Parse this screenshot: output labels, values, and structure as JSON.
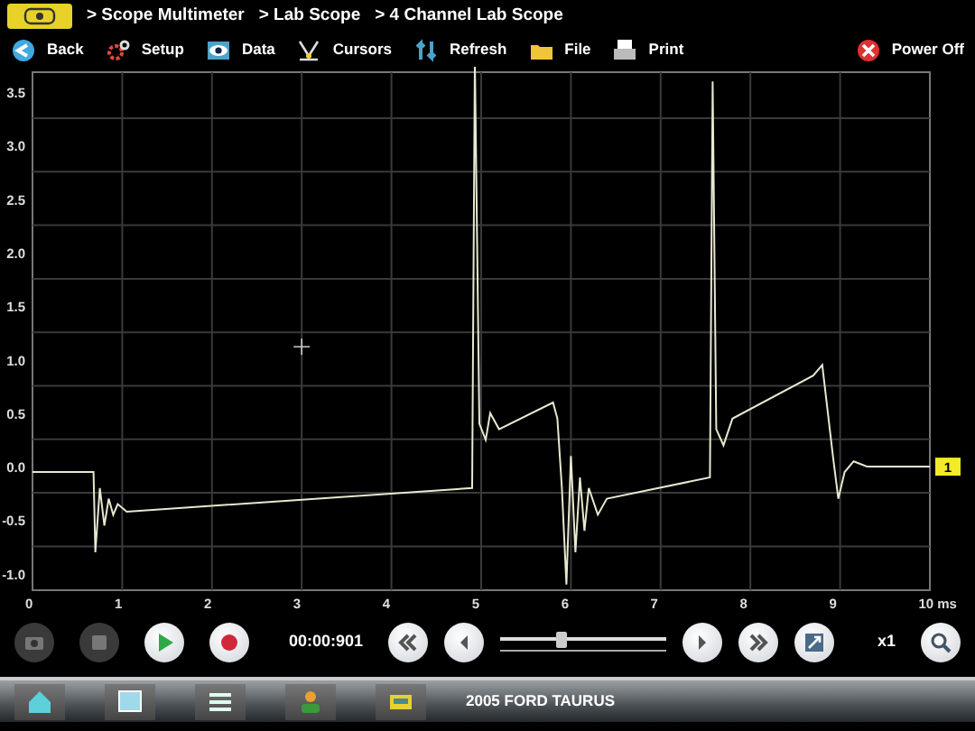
{
  "breadcrumbs": [
    "> Scope Multimeter",
    "> Lab Scope",
    "> 4 Channel Lab Scope"
  ],
  "toolbar": [
    {
      "label": "Back",
      "kind": "back"
    },
    {
      "label": "Setup",
      "kind": "setup"
    },
    {
      "label": "Data",
      "kind": "data"
    },
    {
      "label": "Cursors",
      "kind": "cursors"
    },
    {
      "label": "Refresh",
      "kind": "refresh"
    },
    {
      "label": "File",
      "kind": "file"
    },
    {
      "label": "Print",
      "kind": "print"
    }
  ],
  "power": {
    "label": "Power Off"
  },
  "scope": {
    "y_ticks": [
      "3.5",
      "3.0",
      "2.5",
      "2.0",
      "1.5",
      "1.0",
      "0.5",
      "0.0",
      "-0.5",
      "-1.0"
    ],
    "x_ticks": [
      "0",
      "1",
      "2",
      "3",
      "4",
      "5",
      "6",
      "7",
      "8",
      "9",
      "10 ms"
    ],
    "channel_marker": "1"
  },
  "controls": [
    {
      "kind": "camera",
      "disabled": true
    },
    {
      "kind": "stop",
      "disabled": true
    },
    {
      "kind": "play",
      "disabled": false
    },
    {
      "kind": "record",
      "disabled": false
    }
  ],
  "time": "00:00:901",
  "playback": {
    "level": 0.36
  },
  "zoom_label": "x1",
  "vehicle": "2005 FORD TAURUS"
}
